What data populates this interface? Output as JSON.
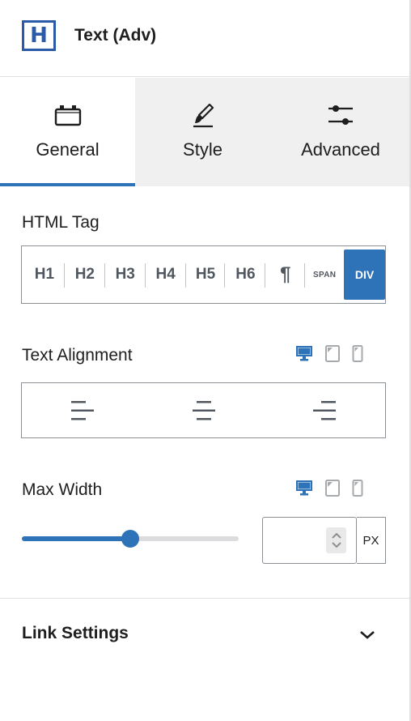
{
  "header": {
    "logo_letter": "H",
    "title": "Text (Adv)"
  },
  "tabs": [
    {
      "label": "General",
      "icon": "toolbox-icon",
      "active": true
    },
    {
      "label": "Style",
      "icon": "brush-icon",
      "active": false
    },
    {
      "label": "Advanced",
      "icon": "sliders-icon",
      "active": false
    }
  ],
  "html_tag": {
    "label": "HTML Tag",
    "options": [
      "H1",
      "H2",
      "H3",
      "H4",
      "H5",
      "H6",
      "¶",
      "SPAN",
      "DIV"
    ],
    "selected": "DIV"
  },
  "text_alignment": {
    "label": "Text Alignment",
    "devices": [
      "desktop-icon",
      "tablet-icon",
      "mobile-icon"
    ],
    "active_device": "desktop",
    "options": [
      "align-left-icon",
      "align-center-icon",
      "align-right-icon"
    ]
  },
  "max_width": {
    "label": "Max Width",
    "devices": [
      "desktop-icon",
      "tablet-icon",
      "mobile-icon"
    ],
    "active_device": "desktop",
    "slider_fraction": 0.5,
    "value": "",
    "unit": "PX"
  },
  "link_settings": {
    "label": "Link Settings",
    "icon": "chevron-down-icon"
  },
  "colors": {
    "accent": "#2e73b8",
    "logo": "#2a5aa8",
    "inactive_tab": "#f0f0f1"
  }
}
